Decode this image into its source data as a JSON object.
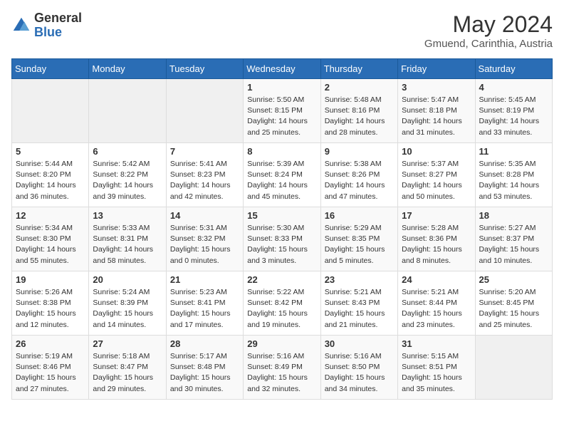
{
  "header": {
    "logo_general": "General",
    "logo_blue": "Blue",
    "title": "May 2024",
    "location": "Gmuend, Carinthia, Austria"
  },
  "weekdays": [
    "Sunday",
    "Monday",
    "Tuesday",
    "Wednesday",
    "Thursday",
    "Friday",
    "Saturday"
  ],
  "weeks": [
    [
      {
        "day": "",
        "info": ""
      },
      {
        "day": "",
        "info": ""
      },
      {
        "day": "",
        "info": ""
      },
      {
        "day": "1",
        "info": "Sunrise: 5:50 AM\nSunset: 8:15 PM\nDaylight: 14 hours\nand 25 minutes."
      },
      {
        "day": "2",
        "info": "Sunrise: 5:48 AM\nSunset: 8:16 PM\nDaylight: 14 hours\nand 28 minutes."
      },
      {
        "day": "3",
        "info": "Sunrise: 5:47 AM\nSunset: 8:18 PM\nDaylight: 14 hours\nand 31 minutes."
      },
      {
        "day": "4",
        "info": "Sunrise: 5:45 AM\nSunset: 8:19 PM\nDaylight: 14 hours\nand 33 minutes."
      }
    ],
    [
      {
        "day": "5",
        "info": "Sunrise: 5:44 AM\nSunset: 8:20 PM\nDaylight: 14 hours\nand 36 minutes."
      },
      {
        "day": "6",
        "info": "Sunrise: 5:42 AM\nSunset: 8:22 PM\nDaylight: 14 hours\nand 39 minutes."
      },
      {
        "day": "7",
        "info": "Sunrise: 5:41 AM\nSunset: 8:23 PM\nDaylight: 14 hours\nand 42 minutes."
      },
      {
        "day": "8",
        "info": "Sunrise: 5:39 AM\nSunset: 8:24 PM\nDaylight: 14 hours\nand 45 minutes."
      },
      {
        "day": "9",
        "info": "Sunrise: 5:38 AM\nSunset: 8:26 PM\nDaylight: 14 hours\nand 47 minutes."
      },
      {
        "day": "10",
        "info": "Sunrise: 5:37 AM\nSunset: 8:27 PM\nDaylight: 14 hours\nand 50 minutes."
      },
      {
        "day": "11",
        "info": "Sunrise: 5:35 AM\nSunset: 8:28 PM\nDaylight: 14 hours\nand 53 minutes."
      }
    ],
    [
      {
        "day": "12",
        "info": "Sunrise: 5:34 AM\nSunset: 8:30 PM\nDaylight: 14 hours\nand 55 minutes."
      },
      {
        "day": "13",
        "info": "Sunrise: 5:33 AM\nSunset: 8:31 PM\nDaylight: 14 hours\nand 58 minutes."
      },
      {
        "day": "14",
        "info": "Sunrise: 5:31 AM\nSunset: 8:32 PM\nDaylight: 15 hours\nand 0 minutes."
      },
      {
        "day": "15",
        "info": "Sunrise: 5:30 AM\nSunset: 8:33 PM\nDaylight: 15 hours\nand 3 minutes."
      },
      {
        "day": "16",
        "info": "Sunrise: 5:29 AM\nSunset: 8:35 PM\nDaylight: 15 hours\nand 5 minutes."
      },
      {
        "day": "17",
        "info": "Sunrise: 5:28 AM\nSunset: 8:36 PM\nDaylight: 15 hours\nand 8 minutes."
      },
      {
        "day": "18",
        "info": "Sunrise: 5:27 AM\nSunset: 8:37 PM\nDaylight: 15 hours\nand 10 minutes."
      }
    ],
    [
      {
        "day": "19",
        "info": "Sunrise: 5:26 AM\nSunset: 8:38 PM\nDaylight: 15 hours\nand 12 minutes."
      },
      {
        "day": "20",
        "info": "Sunrise: 5:24 AM\nSunset: 8:39 PM\nDaylight: 15 hours\nand 14 minutes."
      },
      {
        "day": "21",
        "info": "Sunrise: 5:23 AM\nSunset: 8:41 PM\nDaylight: 15 hours\nand 17 minutes."
      },
      {
        "day": "22",
        "info": "Sunrise: 5:22 AM\nSunset: 8:42 PM\nDaylight: 15 hours\nand 19 minutes."
      },
      {
        "day": "23",
        "info": "Sunrise: 5:21 AM\nSunset: 8:43 PM\nDaylight: 15 hours\nand 21 minutes."
      },
      {
        "day": "24",
        "info": "Sunrise: 5:21 AM\nSunset: 8:44 PM\nDaylight: 15 hours\nand 23 minutes."
      },
      {
        "day": "25",
        "info": "Sunrise: 5:20 AM\nSunset: 8:45 PM\nDaylight: 15 hours\nand 25 minutes."
      }
    ],
    [
      {
        "day": "26",
        "info": "Sunrise: 5:19 AM\nSunset: 8:46 PM\nDaylight: 15 hours\nand 27 minutes."
      },
      {
        "day": "27",
        "info": "Sunrise: 5:18 AM\nSunset: 8:47 PM\nDaylight: 15 hours\nand 29 minutes."
      },
      {
        "day": "28",
        "info": "Sunrise: 5:17 AM\nSunset: 8:48 PM\nDaylight: 15 hours\nand 30 minutes."
      },
      {
        "day": "29",
        "info": "Sunrise: 5:16 AM\nSunset: 8:49 PM\nDaylight: 15 hours\nand 32 minutes."
      },
      {
        "day": "30",
        "info": "Sunrise: 5:16 AM\nSunset: 8:50 PM\nDaylight: 15 hours\nand 34 minutes."
      },
      {
        "day": "31",
        "info": "Sunrise: 5:15 AM\nSunset: 8:51 PM\nDaylight: 15 hours\nand 35 minutes."
      },
      {
        "day": "",
        "info": ""
      }
    ]
  ]
}
